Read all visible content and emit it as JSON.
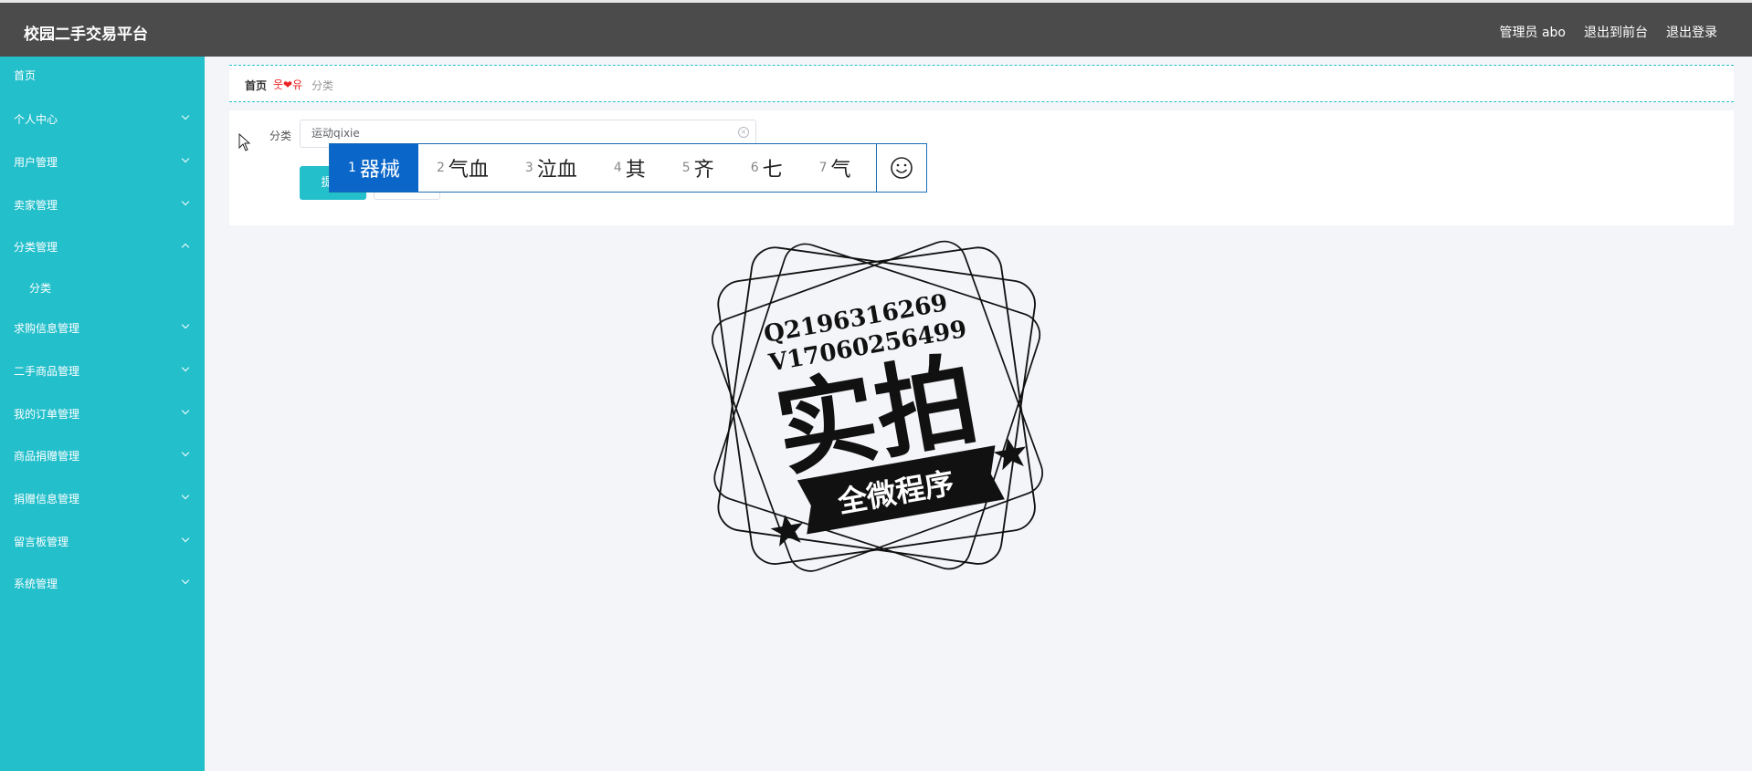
{
  "header": {
    "title": "校园二手交易平台",
    "admin_label": "管理员 abo",
    "exit_front": "退出到前台",
    "logout": "退出登录"
  },
  "sidebar": {
    "items": [
      {
        "label": "首页"
      },
      {
        "label": "个人中心"
      },
      {
        "label": "用户管理"
      },
      {
        "label": "卖家管理"
      },
      {
        "label": "分类管理"
      },
      {
        "label": "分类"
      },
      {
        "label": "求购信息管理"
      },
      {
        "label": "二手商品管理"
      },
      {
        "label": "我的订单管理"
      },
      {
        "label": "商品捐赠管理"
      },
      {
        "label": "捐赠信息管理"
      },
      {
        "label": "留言板管理"
      },
      {
        "label": "系统管理"
      }
    ]
  },
  "breadcrumb": {
    "home": "首页",
    "separator": "웃❤유",
    "current": "分类"
  },
  "form": {
    "field_label": "分类",
    "input_value": "运动qixie",
    "primary_button": "提交"
  },
  "ime": {
    "candidates": [
      {
        "num": "1",
        "text": "器械"
      },
      {
        "num": "2",
        "text": "气血"
      },
      {
        "num": "3",
        "text": "泣血"
      },
      {
        "num": "4",
        "text": "其"
      },
      {
        "num": "5",
        "text": "齐"
      },
      {
        "num": "6",
        "text": "七"
      },
      {
        "num": "7",
        "text": "气"
      }
    ]
  },
  "watermark": {
    "line1": "Q2196316269",
    "line2": "V17060256499",
    "big": "实拍",
    "ribbon": "全微程序"
  },
  "colors": {
    "accent": "#23bfcb",
    "topbar": "#4b4b4b",
    "ime_selected": "#0a66c8"
  }
}
